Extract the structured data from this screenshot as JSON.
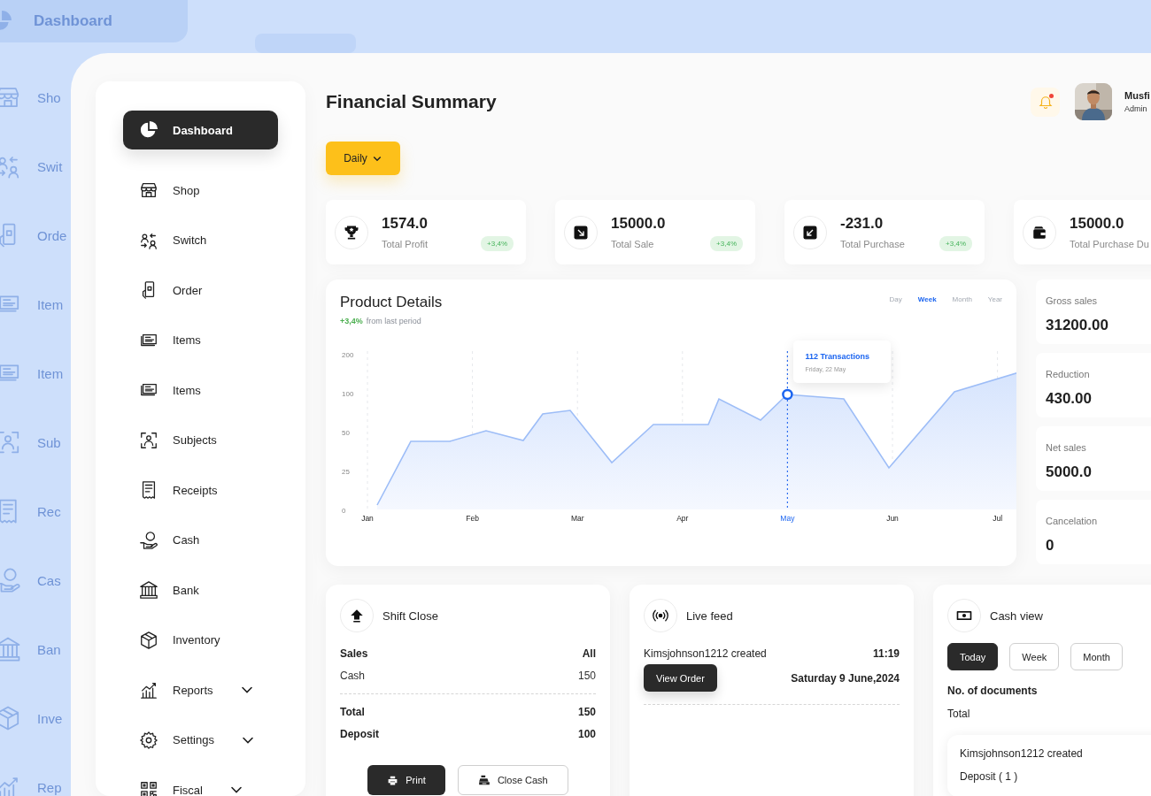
{
  "background_layer": {
    "dashboard_label": "Dashboard",
    "items": [
      "Sho",
      "Swit",
      "Orde",
      "Item",
      "Item",
      "Sub",
      "Rec",
      "Cas",
      "Ban",
      "Inve",
      "Rep"
    ]
  },
  "sidebar": {
    "items": [
      {
        "label": "Dashboard",
        "selected": true,
        "kind": "link"
      },
      {
        "label": "Shop",
        "selected": false,
        "kind": "link"
      },
      {
        "label": "Switch",
        "selected": false,
        "kind": "link"
      },
      {
        "label": "Order",
        "selected": false,
        "kind": "link"
      },
      {
        "label": "Items",
        "selected": false,
        "kind": "link"
      },
      {
        "label": "Items",
        "selected": false,
        "kind": "link"
      },
      {
        "label": "Subjects",
        "selected": false,
        "kind": "link"
      },
      {
        "label": "Receipts",
        "selected": false,
        "kind": "link"
      },
      {
        "label": "Cash",
        "selected": false,
        "kind": "link"
      },
      {
        "label": "Bank",
        "selected": false,
        "kind": "link"
      },
      {
        "label": "Inventory",
        "selected": false,
        "kind": "link"
      },
      {
        "label": "Reports",
        "selected": false,
        "kind": "group",
        "expanded": false
      },
      {
        "label": "Settings",
        "selected": false,
        "kind": "group",
        "expanded": false
      },
      {
        "label": "Fiscal",
        "selected": false,
        "kind": "group",
        "expanded": false
      }
    ]
  },
  "header": {
    "title": "Financial Summary",
    "notification_dot": true,
    "user": {
      "name": "Musfi",
      "role": "Admin"
    }
  },
  "period_dropdown": "Daily",
  "stats": [
    {
      "value": "1574.0",
      "label": "Total Profit",
      "badge": "+3,4%"
    },
    {
      "value": "15000.0",
      "label": "Total Sale",
      "badge": "+3,4%"
    },
    {
      "value": "-231.0",
      "label": "Total Purchase",
      "badge": "+3,4%"
    },
    {
      "value": "15000.0",
      "label": "Total Purchase Du"
    }
  ],
  "product_details": {
    "title": "Product Details",
    "change": "+3,4%",
    "change_note": "from last period",
    "ranges": [
      {
        "label": "Day",
        "selected": false
      },
      {
        "label": "Week",
        "selected": true
      },
      {
        "label": "Month",
        "selected": false
      },
      {
        "label": "Year",
        "selected": false
      }
    ],
    "y_axis_labels": [
      "200",
      "100",
      "50",
      "25",
      "0"
    ],
    "x_axis_labels": [
      {
        "label": "Jan",
        "selected": false
      },
      {
        "label": "Feb",
        "selected": false
      },
      {
        "label": "Mar",
        "selected": false
      },
      {
        "label": "Apr",
        "selected": false
      },
      {
        "label": "May",
        "selected": true
      },
      {
        "label": "Jun",
        "selected": false
      },
      {
        "label": "Jul",
        "selected": false
      }
    ],
    "tooltip": {
      "title": "112 Transactions",
      "date": "Friday, 22 May"
    }
  },
  "side_stats": [
    {
      "label": "Gross sales",
      "value": "31200.00"
    },
    {
      "label": "Reduction",
      "value": "430.00"
    },
    {
      "label": "Net sales",
      "value": "5000.0"
    },
    {
      "label": "Cancelation",
      "value": "0"
    }
  ],
  "shift_close": {
    "title": "Shift Close",
    "rows": [
      {
        "kind": "bold",
        "label": "Sales",
        "value": "All"
      },
      {
        "kind": "plain",
        "label": "Cash",
        "value": "150"
      },
      {
        "kind": "divider"
      },
      {
        "kind": "bold",
        "label": "Total",
        "value": "150"
      },
      {
        "kind": "bold",
        "label": "Deposit",
        "value": "100"
      }
    ],
    "buttons": [
      {
        "label": "Print",
        "kind": "primary"
      },
      {
        "label": "Close Cash",
        "kind": "outline"
      }
    ]
  },
  "live_feed": {
    "title": "Live feed",
    "entries": [
      {
        "text": "Kimsjohnson1212 created",
        "time": "11:19",
        "action": "View Order",
        "date": "Saturday 9 June,2024"
      }
    ]
  },
  "cash_view": {
    "title": "Cash view",
    "tabs": [
      {
        "label": "Today",
        "selected": true
      },
      {
        "label": "Week",
        "selected": false
      },
      {
        "label": "Month",
        "selected": false
      }
    ],
    "documents_label": "No. of documents",
    "total_label": "Total",
    "entry": {
      "text": "Kimsjohnson1212 created",
      "detail": "Deposit ( 1 )"
    }
  }
}
